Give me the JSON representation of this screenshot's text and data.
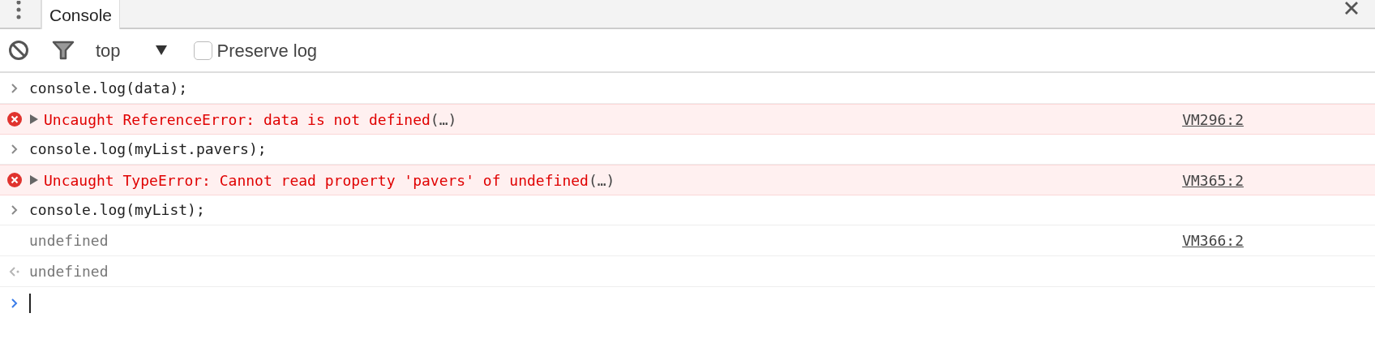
{
  "tabs": [
    {
      "label": "Console",
      "selected": true
    }
  ],
  "toolbar": {
    "context": "top",
    "preserve_log": {
      "label": "Preserve log",
      "checked": false
    }
  },
  "entries": [
    {
      "kind": "input",
      "text": "console.log(data);"
    },
    {
      "kind": "error",
      "text": "Uncaught ReferenceError: data is not defined",
      "suffix": "(…)",
      "source": "VM296:2"
    },
    {
      "kind": "input",
      "text": "console.log(myList.pavers);"
    },
    {
      "kind": "error",
      "text": "Uncaught TypeError: Cannot read property 'pavers' of undefined",
      "suffix": "(…)",
      "source": "VM365:2"
    },
    {
      "kind": "input",
      "text": "console.log(myList);"
    },
    {
      "kind": "log",
      "text": "undefined",
      "source": "VM366:2"
    },
    {
      "kind": "result",
      "text": "undefined"
    }
  ]
}
